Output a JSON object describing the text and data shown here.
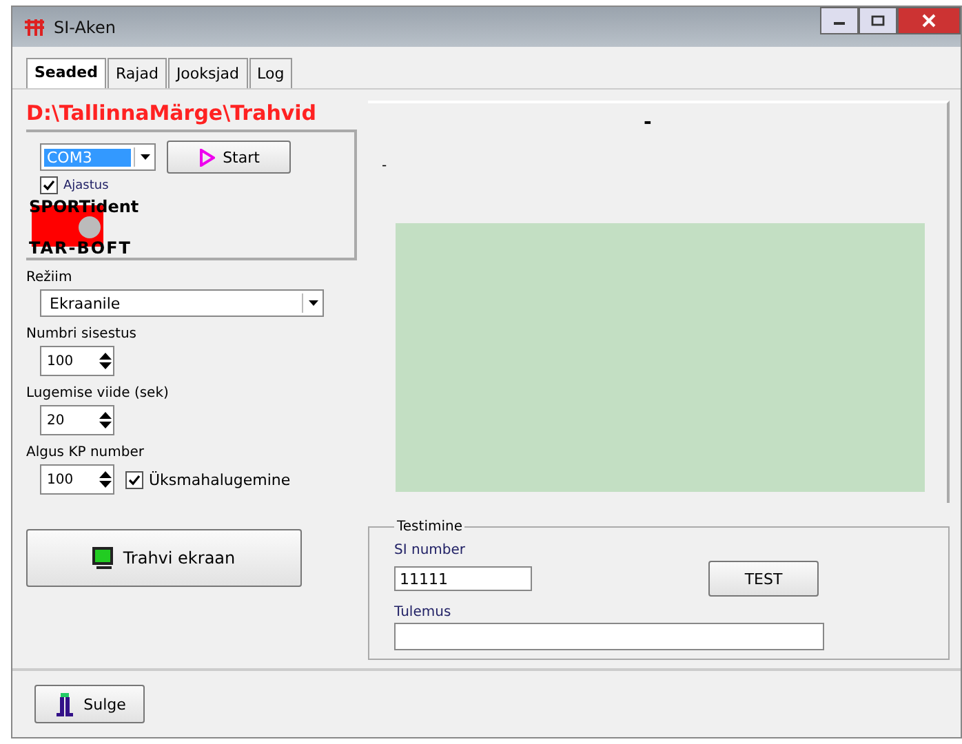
{
  "window": {
    "title": "SI-Aken"
  },
  "tabs": [
    {
      "label": "Seaded",
      "selected": true
    },
    {
      "label": "Rajad",
      "selected": false
    },
    {
      "label": "Jooksjad",
      "selected": false
    },
    {
      "label": "Log",
      "selected": false
    }
  ],
  "path": "D:\\TallinnaMärge\\Trahvid",
  "reader": {
    "port": "COM3",
    "start_button": "Start",
    "auto": {
      "label": "Ajastus",
      "checked": true
    },
    "brand": "SPORTident",
    "brand_sub": "TAR-BOFT"
  },
  "mode": {
    "label": "Režiim",
    "value": "Ekraanile"
  },
  "spinners": [
    {
      "label": "Numbri sisestus",
      "value": "100"
    },
    {
      "label": "Lugemise viide (sek)",
      "value": "20"
    }
  ],
  "start_cp": {
    "label": "Algus KP number",
    "value": "100",
    "option": {
      "label": "Üksmahalugemine",
      "checked": true
    }
  },
  "screen_button": "Trahvi ekraan",
  "preview": {
    "marks": [
      "-",
      "-"
    ]
  },
  "test": {
    "title": "Testimine",
    "si_label": "SI number",
    "si_value": "11111",
    "button": "TEST",
    "result_label": "Tulemus"
  },
  "close_button": "Sulge"
}
